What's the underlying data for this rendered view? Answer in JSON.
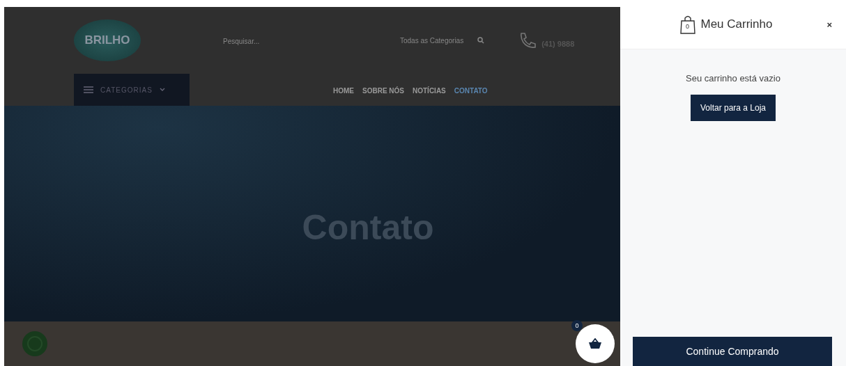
{
  "site": {
    "logo": "BRILHO",
    "search": {
      "placeholder": "Pesquisar..."
    },
    "category_select": "Todas as Categorias",
    "phone": "(41) 9888",
    "categories_button": "CATEGORIAS",
    "nav": [
      {
        "label": "HOME",
        "selected": false
      },
      {
        "label": "SOBRE NÓS",
        "selected": false
      },
      {
        "label": "NOTÍCIAS",
        "selected": false
      },
      {
        "label": "CONTATO",
        "selected": true
      }
    ],
    "hero_title": "Contato",
    "cart_count": "0"
  },
  "cart": {
    "title": "Meu Carrinho",
    "bag_count": "0",
    "close": "×",
    "empty_message": "Seu carrinho está vazio",
    "back_button": "Voltar para a Loja",
    "continue_button": "Continue Comprando"
  }
}
